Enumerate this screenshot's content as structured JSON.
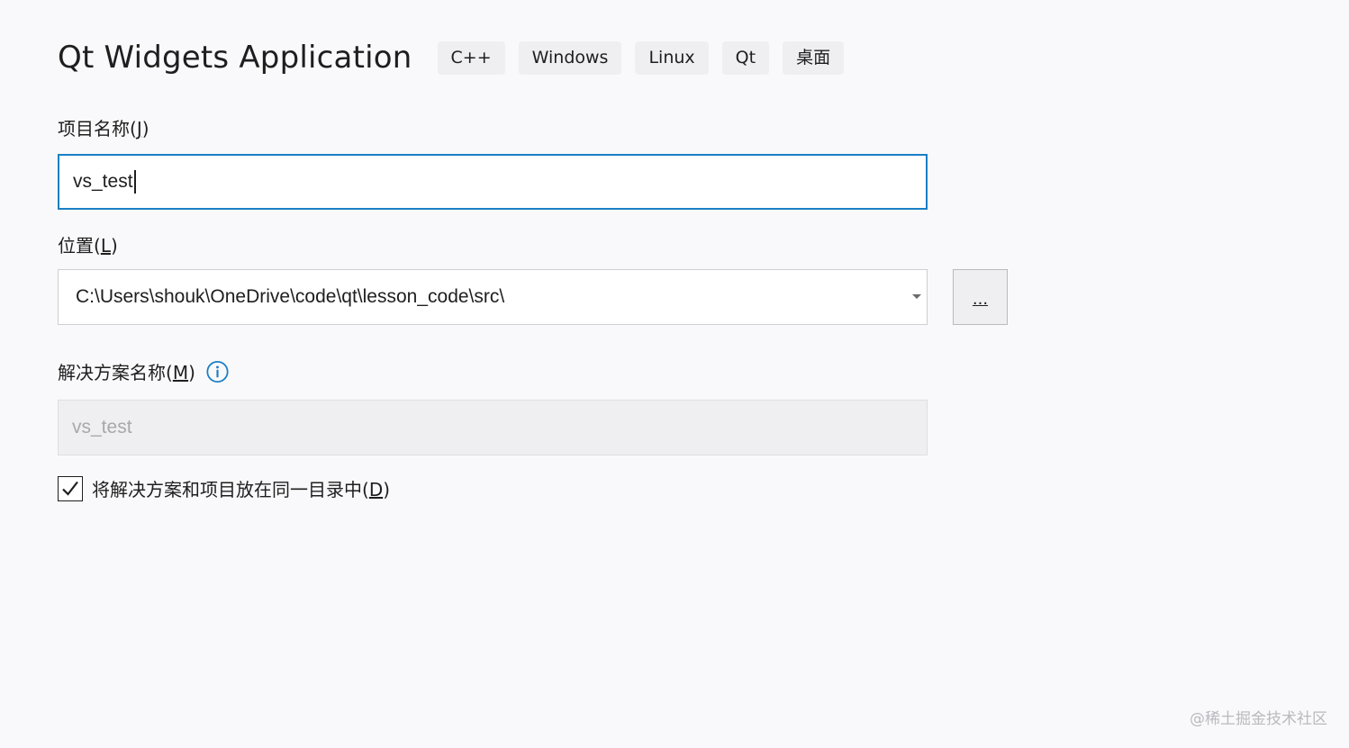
{
  "header": {
    "title": "Qt Widgets Application",
    "tags": [
      "C++",
      "Windows",
      "Linux",
      "Qt",
      "桌面"
    ]
  },
  "project_name": {
    "label": "项目名称(",
    "accel": "J",
    "label_end": ")",
    "value": "vs_test"
  },
  "location": {
    "label": "位置(",
    "accel": "L",
    "label_end": ")",
    "value": "C:\\Users\\shouk\\OneDrive\\code\\qt\\lesson_code\\src\\",
    "browse_label": "..."
  },
  "solution_name": {
    "label": "解决方案名称(",
    "accel": "M",
    "label_end": ")",
    "value": "vs_test",
    "info_icon": "info-icon"
  },
  "same_directory": {
    "label": "将解决方案和项目放在同一目录中(",
    "accel": "D",
    "label_end": ")",
    "checked": true
  },
  "watermark": "@稀土掘金技术社区",
  "colors": {
    "accent": "#1b7fc4",
    "background": "#f9f9fb",
    "tag_bg": "#efeff2"
  }
}
